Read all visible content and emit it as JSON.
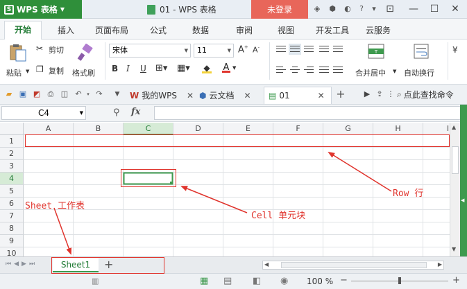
{
  "titlebar": {
    "app_name": "WPS 表格",
    "doc_title": "01 - WPS 表格",
    "login": "未登录"
  },
  "ribbon": {
    "tabs": [
      "开始",
      "插入",
      "页面布局",
      "公式",
      "数据",
      "审阅",
      "视图",
      "开发工具",
      "云服务"
    ],
    "paste": "粘贴",
    "cut": "剪切",
    "copy": "复制",
    "format_painter": "格式刷",
    "font_name": "宋体",
    "font_size": "11",
    "merge_center": "合并居中",
    "wrap_text": "自动换行"
  },
  "doc_tabs": {
    "my_wps": "我的WPS",
    "cloud_docs": "云文档",
    "current": "01",
    "search_cmd": "点此查找命令"
  },
  "formula_bar": {
    "name_box": "C4",
    "fx": "fx",
    "value": ""
  },
  "grid": {
    "columns": [
      "A",
      "B",
      "C",
      "D",
      "E",
      "F",
      "G",
      "H",
      "I"
    ],
    "rows": [
      "1",
      "2",
      "3",
      "4",
      "5",
      "6",
      "7",
      "8",
      "9",
      "10"
    ],
    "selected_cell": "C4"
  },
  "sheets": [
    "Sheet1"
  ],
  "statusbar": {
    "zoom": "100 %"
  },
  "annotations": {
    "row": "Row 行",
    "cell": "Cell 单元块",
    "sheet": "Sheet 工作表"
  },
  "colors": {
    "accent_green": "#3e9a4e",
    "login_red": "#e8665a",
    "annotation_red": "#e0342d"
  }
}
